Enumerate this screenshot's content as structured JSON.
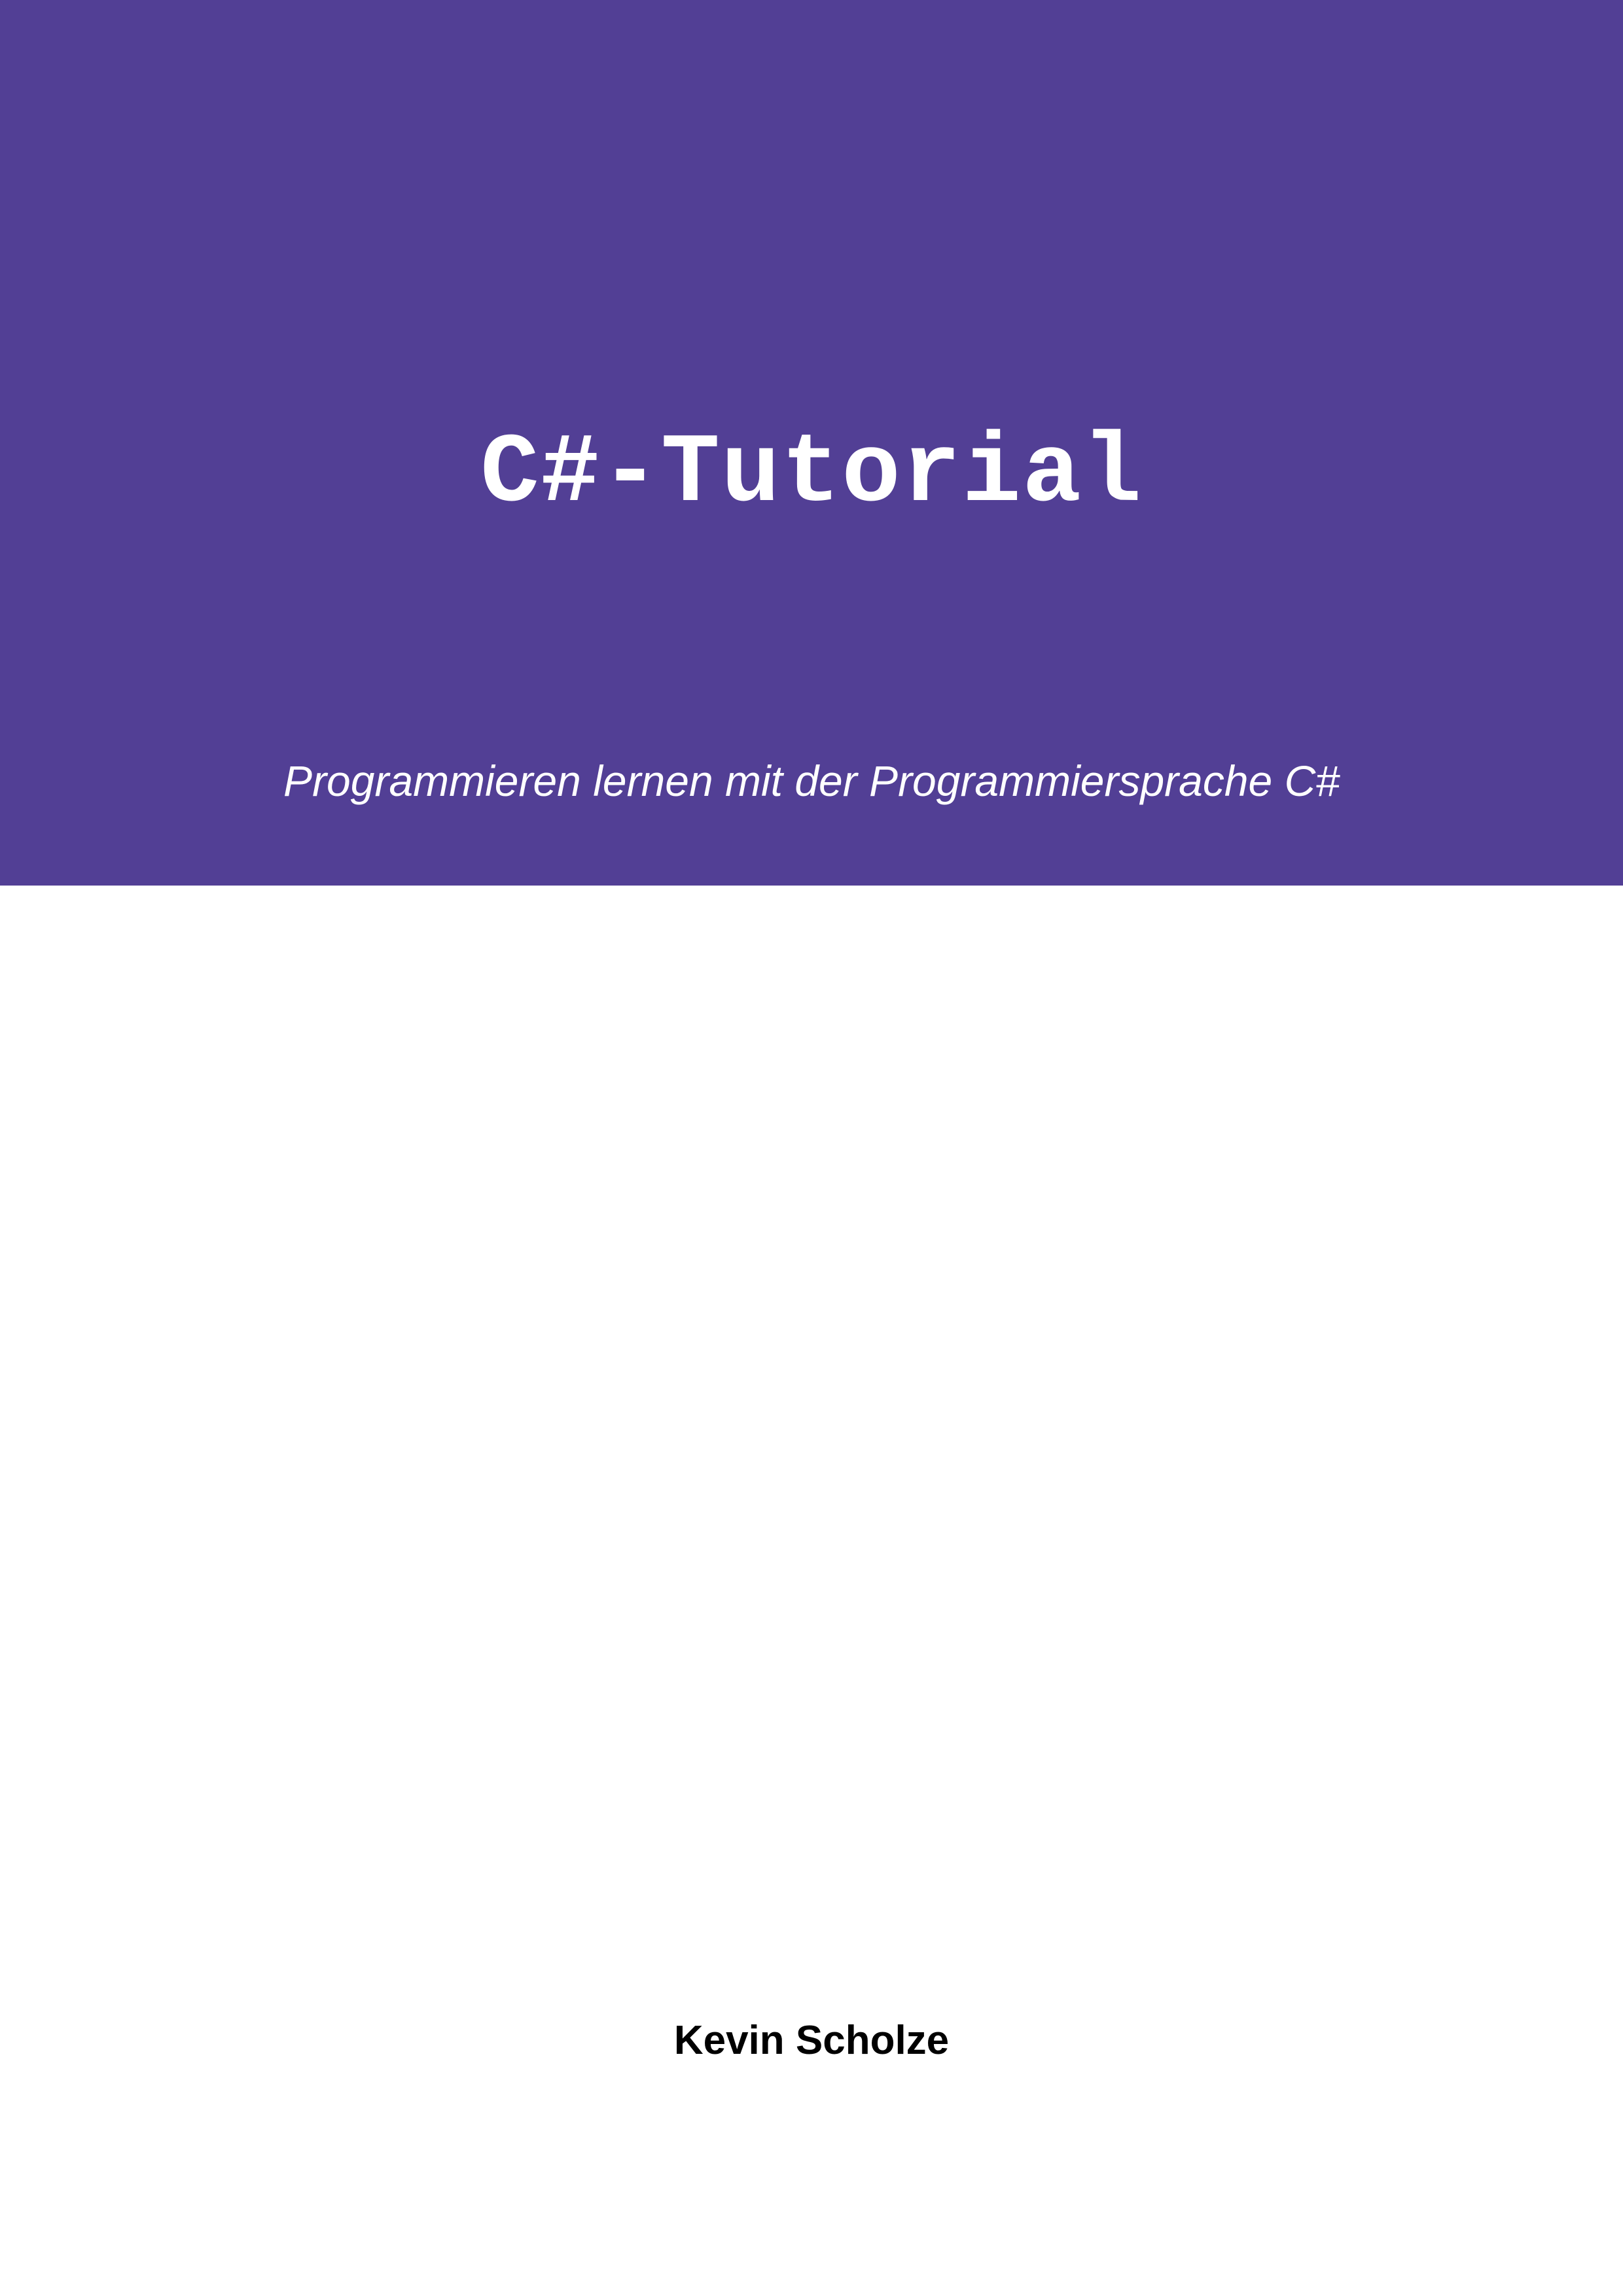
{
  "cover": {
    "title": "C#-Tutorial",
    "subtitle": "Programmieren lernen mit der Programmiersprache C#",
    "author": "Kevin Scholze"
  }
}
